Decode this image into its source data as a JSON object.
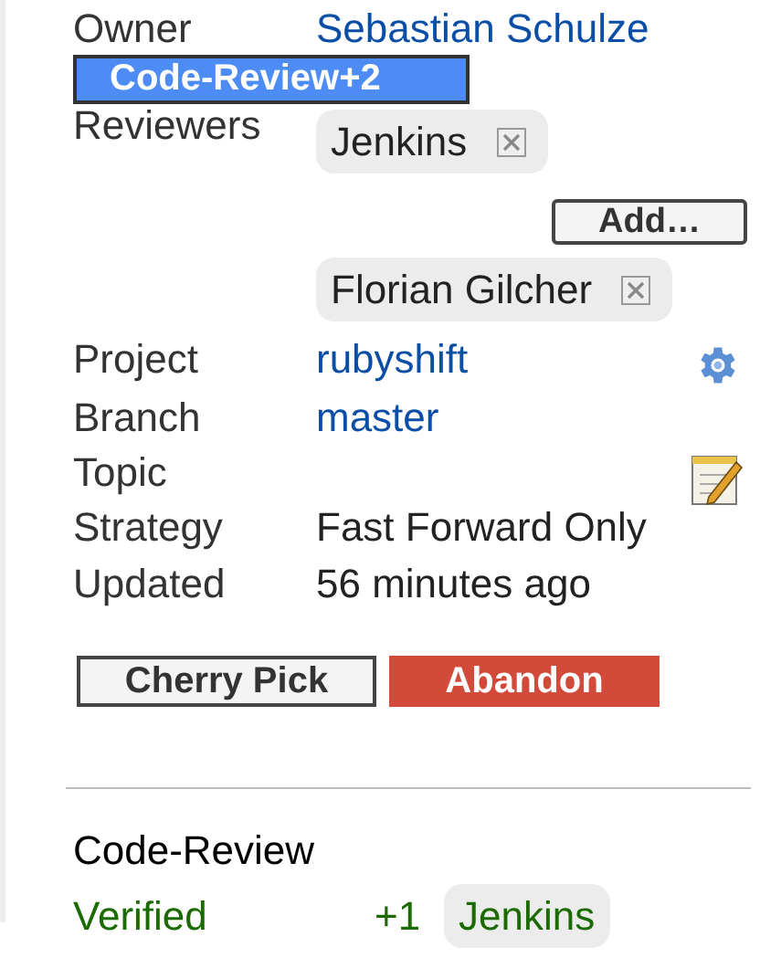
{
  "tooltip": {
    "text": "Code-Review+2"
  },
  "fields": [
    {
      "kind": "link",
      "label": "Owner",
      "value": "Sebastian Schulze"
    },
    {
      "kind": "reviewers",
      "label": "Reviewers",
      "entries": [
        {
          "kind": "chip",
          "text": "Jenkins"
        },
        {
          "kind": "add-button",
          "text": "Add…"
        },
        {
          "kind": "chip",
          "text": "Florian Gilcher"
        }
      ]
    },
    {
      "kind": "project",
      "label": "Project",
      "value": "rubyshift"
    },
    {
      "kind": "link",
      "label": "Branch",
      "value": "master"
    },
    {
      "kind": "topic",
      "label": "Topic"
    },
    {
      "kind": "text",
      "label": "Strategy",
      "value": "Fast Forward Only"
    },
    {
      "kind": "text",
      "label": "Updated",
      "value": "56 minutes ago"
    }
  ],
  "actions": [
    {
      "label": "Cherry Pick",
      "kind": "plain"
    },
    {
      "label": "Abandon",
      "kind": "danger"
    }
  ],
  "labels": [
    {
      "name": "Code-Review",
      "approved": false
    },
    {
      "name": "Verified",
      "approved": true,
      "score": "+1",
      "voter": "Jenkins"
    }
  ]
}
